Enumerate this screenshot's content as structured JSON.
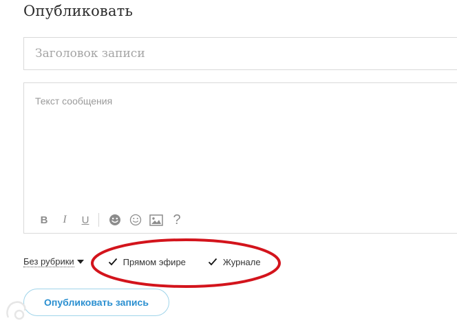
{
  "page": {
    "title": "Опубликовать"
  },
  "form": {
    "title_placeholder": "Заголовок записи",
    "title_value": "",
    "message_placeholder": "Текст сообщения",
    "message_value": ""
  },
  "toolbar": {
    "bold_label": "B",
    "italic_label": "I",
    "underline_label": "U",
    "help_label": "?",
    "icons": [
      "bold-icon",
      "italic-icon",
      "underline-icon",
      "emoji-filled-icon",
      "emoji-outline-icon",
      "image-icon",
      "help-icon"
    ]
  },
  "options": {
    "rubric_label": "Без рубрики",
    "checkbox_live_label": "Прямом эфире",
    "checkbox_live_checked": true,
    "checkbox_journal_label": "Журнале",
    "checkbox_journal_checked": true
  },
  "actions": {
    "publish_label": "Опубликовать запись"
  },
  "colors": {
    "accent": "#2a8fd0",
    "button_border": "#9fd4ea",
    "highlight": "#d3141c",
    "border": "#d9d9d9"
  }
}
